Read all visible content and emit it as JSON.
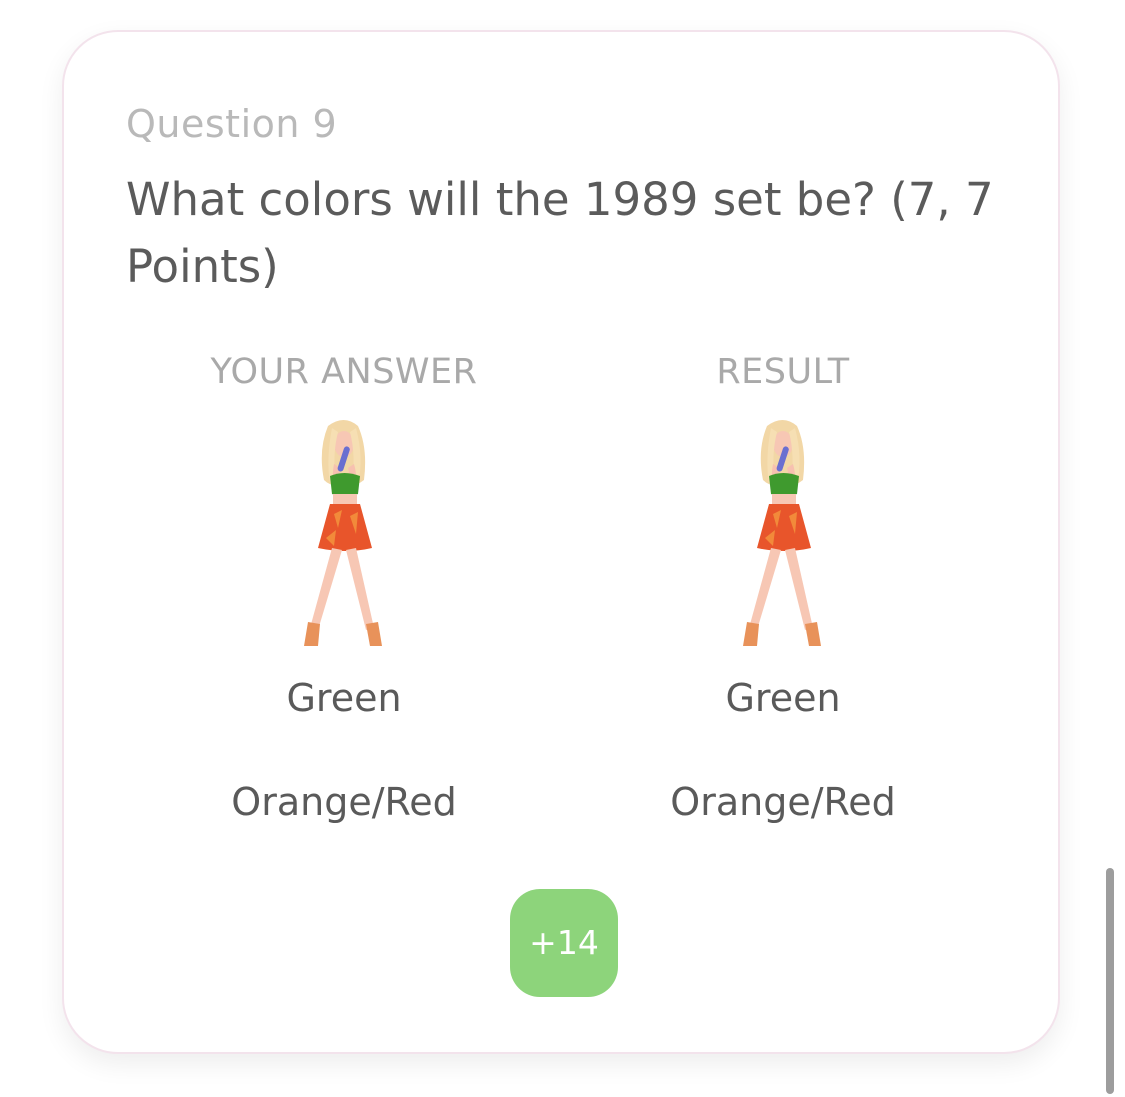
{
  "question": {
    "number_label": "Question 9",
    "text": "What colors will the 1989 set be? (7, 7 Points)"
  },
  "columns": {
    "your_answer": {
      "header": "YOUR ANSWER",
      "figure_icon": "outfit-figure-icon",
      "answers": [
        "Green",
        "Orange/Red"
      ]
    },
    "result": {
      "header": "RESULT",
      "figure_icon": "outfit-figure-icon",
      "answers": [
        "Green",
        "Orange/Red"
      ]
    }
  },
  "points_badge": {
    "label": "+14",
    "color": "#8dd47b"
  },
  "colors": {
    "card_border": "#f3e3ec",
    "question_number": "#b9b9b9",
    "question_text": "#5b5b5b",
    "header_text": "#a9a9a9",
    "top_green": "#3f9a2e",
    "skirt_orange": "#e8552b"
  }
}
